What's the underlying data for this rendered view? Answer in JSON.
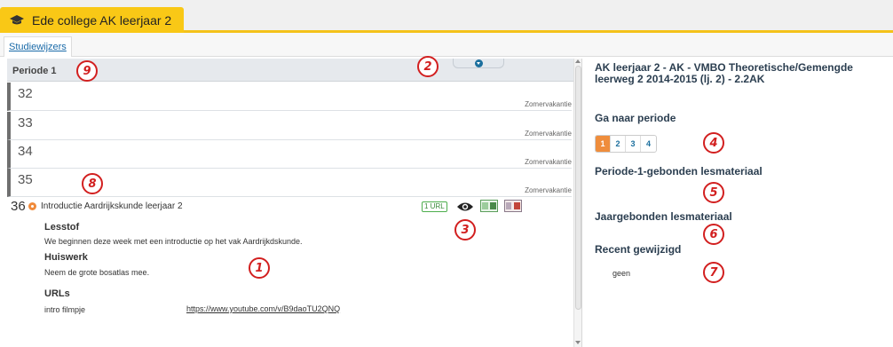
{
  "course_tab": {
    "label": "Ede college AK leerjaar 2",
    "icon": "graduation-cap-icon"
  },
  "sub_tab": {
    "label": "Studiewijzers"
  },
  "periode": {
    "label": "Periode 1"
  },
  "weeks": [
    {
      "number": "32",
      "note": "Zomervakantie"
    },
    {
      "number": "33",
      "note": "Zomervakantie"
    },
    {
      "number": "34",
      "note": "Zomervakantie"
    },
    {
      "number": "35",
      "note": "Zomervakantie"
    }
  ],
  "active_week": {
    "number": "36",
    "title": "Introductie Aardrijkskunde leerjaar 2",
    "url_badge": "1 URL",
    "lesstof_head": "Lesstof",
    "lesstof_text": "We beginnen deze week met een introductie op het vak Aardrijkdskunde.",
    "huiswerk_head": "Huiswerk",
    "huiswerk_text": "Neem de grote bosatlas mee.",
    "urls_head": "URLs",
    "url_label": "intro filmpje",
    "url_link": "https://www.youtube.com/v/B9daoTU2QNQ"
  },
  "right": {
    "title": "AK leerjaar 2 - AK - VMBO Theoretische/Gemengde leerweg 2 2014-2015 (lj. 2) - 2.2AK",
    "goto_head": "Ga naar periode",
    "periods": [
      "1",
      "2",
      "3",
      "4"
    ],
    "active_period": "1",
    "periode_materiaal_head": "Periode-1-gebonden lesmateriaal",
    "jaar_materiaal_head": "Jaargebonden lesmateriaal",
    "recent_head": "Recent gewijzigd",
    "recent_value": "geen"
  },
  "markers": [
    "1",
    "2",
    "3",
    "4",
    "5",
    "6",
    "7",
    "8",
    "9"
  ],
  "colors": {
    "tab_yellow": "#f9c816",
    "accent_orange": "#ef8d3c",
    "marker_red": "#d21f1f",
    "link_blue": "#1b6f9e"
  }
}
